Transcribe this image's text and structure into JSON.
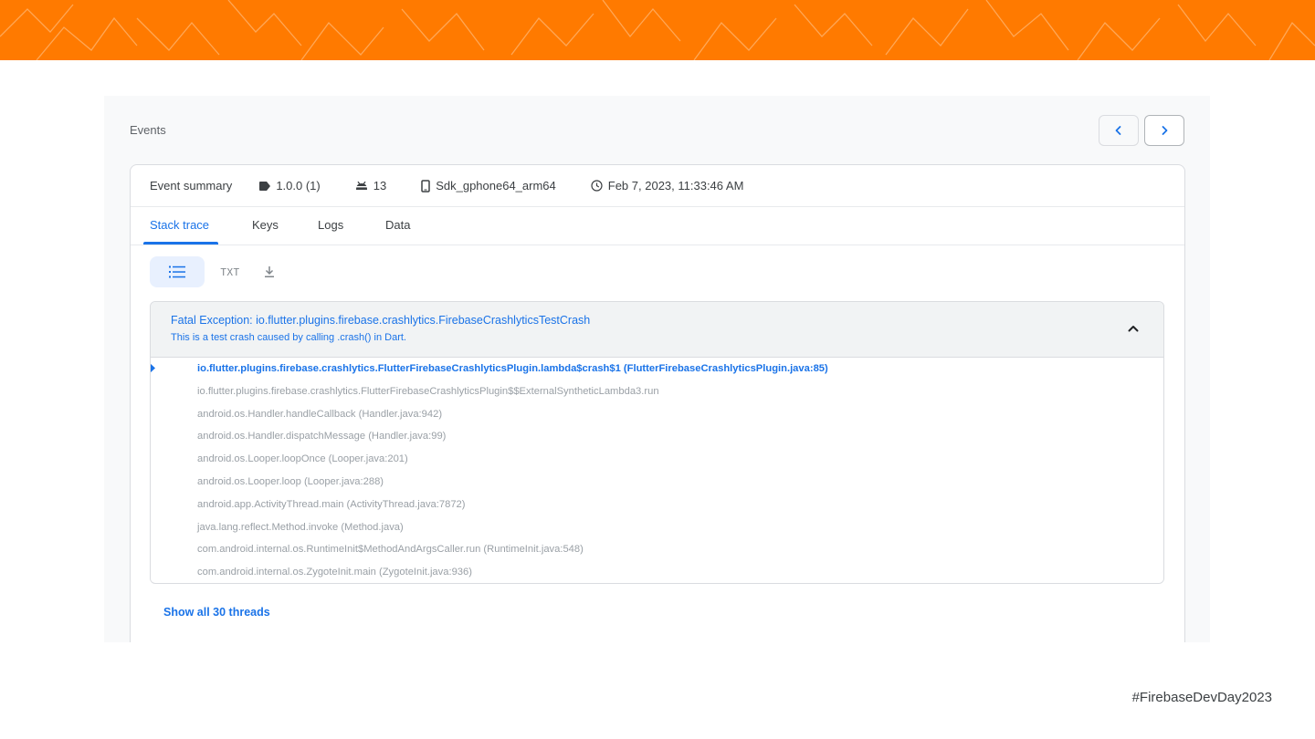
{
  "colors": {
    "banner": "#ff7a00",
    "accent": "#1a73e8",
    "muted": "#9aa0a6"
  },
  "banner": {
    "decoration": "firebase-wordmark-pattern"
  },
  "panel": {
    "title": "Events",
    "nav": {
      "prev_icon": "chevron-left-icon",
      "next_icon": "chevron-right-icon"
    }
  },
  "summary": {
    "label": "Event summary",
    "version": "1.0.0 (1)",
    "os": "13",
    "device": "Sdk_gphone64_arm64",
    "timestamp": "Feb 7, 2023, 11:33:46 AM"
  },
  "tabs": [
    {
      "label": "Stack trace",
      "active": true
    },
    {
      "label": "Keys"
    },
    {
      "label": "Logs"
    },
    {
      "label": "Data"
    }
  ],
  "toolbar": {
    "list_icon": "list-view-icon",
    "txt_label": "TXT",
    "download_icon": "download-icon"
  },
  "exception": {
    "title": "Fatal Exception: io.flutter.plugins.firebase.crashlytics.FirebaseCrashlyticsTestCrash",
    "subtitle": "This is a test crash caused by calling .crash() in Dart.",
    "frames": [
      "io.flutter.plugins.firebase.crashlytics.FlutterFirebaseCrashlyticsPlugin.lambda$crash$1 (FlutterFirebaseCrashlyticsPlugin.java:85)",
      "io.flutter.plugins.firebase.crashlytics.FlutterFirebaseCrashlyticsPlugin$$ExternalSyntheticLambda3.run",
      "android.os.Handler.handleCallback (Handler.java:942)",
      "android.os.Handler.dispatchMessage (Handler.java:99)",
      "android.os.Looper.loopOnce (Looper.java:201)",
      "android.os.Looper.loop (Looper.java:288)",
      "android.app.ActivityThread.main (ActivityThread.java:7872)",
      "java.lang.reflect.Method.invoke (Method.java)",
      "com.android.internal.os.RuntimeInit$MethodAndArgsCaller.run (RuntimeInit.java:548)",
      "com.android.internal.os.ZygoteInit.main (ZygoteInit.java:936)"
    ]
  },
  "threads_link": "Show all 30 threads",
  "hashtag": "#FirebaseDevDay2023"
}
